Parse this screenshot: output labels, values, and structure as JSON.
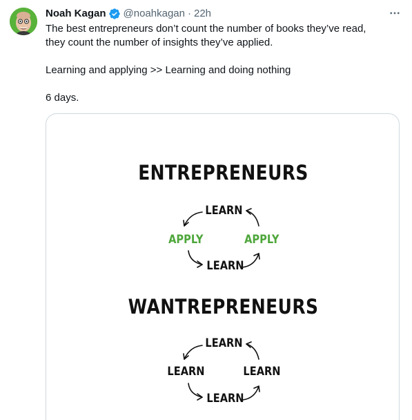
{
  "author": {
    "display_name": "Noah Kagan",
    "handle": "@noahkagan",
    "separator": "·",
    "time": "22h"
  },
  "tweet": {
    "line1": "The best entrepreneurs don’t count the number of books they’ve read,",
    "line2": "they count the number of insights they’ve applied.",
    "line3": "Learning and applying >> Learning and doing nothing",
    "line4": "6 days."
  },
  "image": {
    "section1": {
      "title": "ENTREPRENEURS",
      "top": "LEARN",
      "left": "APPLY",
      "right": "APPLY",
      "bottom": "LEARN"
    },
    "section2": {
      "title": "WANTREPRENEURS",
      "top": "LEARN",
      "left": "LEARN",
      "right": "LEARN",
      "bottom": "LEARN"
    }
  },
  "icons": {
    "verified": "verified-badge-icon",
    "more": "more-options-icon",
    "avatar": "avatar-photo"
  },
  "colors": {
    "verified_blue": "#1d9bf0",
    "apply_green": "#4da63a",
    "secondary_text": "#536471",
    "avatar_background": "#59b23a"
  }
}
